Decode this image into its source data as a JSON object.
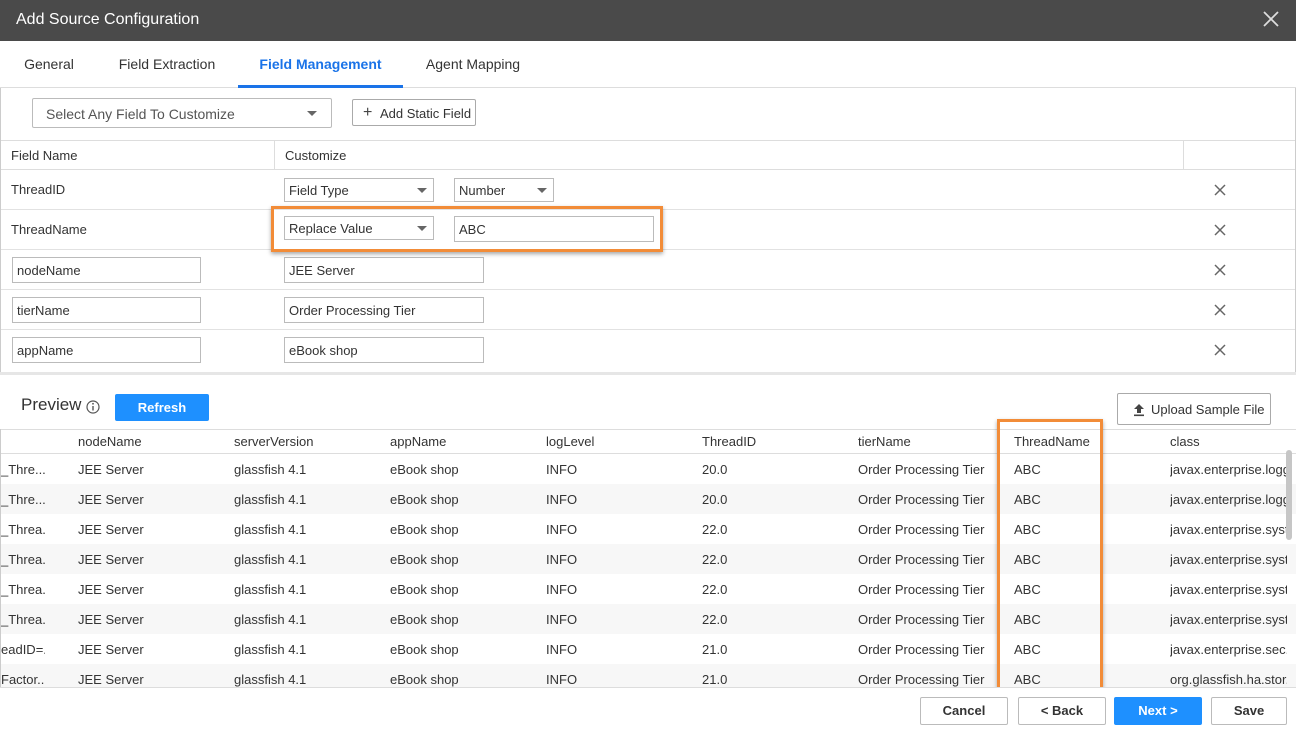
{
  "dialog": {
    "title": "Add Source Configuration",
    "close_icon": "close-icon"
  },
  "tabs": [
    {
      "label": "General",
      "active": false
    },
    {
      "label": "Field Extraction",
      "active": false
    },
    {
      "label": "Field Management",
      "active": true
    },
    {
      "label": "Agent Mapping",
      "active": false
    }
  ],
  "controls": {
    "field_select_placeholder": "Select Any Field To Customize",
    "add_static_field_label": "Add Static Field"
  },
  "field_grid": {
    "headers": [
      "Field Name",
      "Customize"
    ],
    "rows": [
      {
        "name": "ThreadID",
        "customize_type": "Field Type",
        "value": "Number"
      },
      {
        "name": "ThreadName",
        "customize_type": "Replace Value",
        "value": "ABC"
      },
      {
        "name": "nodeName",
        "value": "JEE Server"
      },
      {
        "name": "tierName",
        "value": "Order Processing Tier"
      },
      {
        "name": "appName",
        "value": "eBook shop"
      }
    ]
  },
  "preview": {
    "title": "Preview",
    "refresh_label": "Refresh",
    "upload_label": "Upload Sample File",
    "columns": [
      "",
      "nodeName",
      "serverVersion",
      "appName",
      "logLevel",
      "ThreadID",
      "tierName",
      "ThreadName",
      "class"
    ],
    "rows": [
      [
        "_Thre...",
        "JEE Server",
        "glassfish 4.1",
        "eBook shop",
        "INFO",
        "20.0",
        "Order Processing Tier",
        "ABC",
        "javax.enterprise.logg"
      ],
      [
        "_Thre...",
        "JEE Server",
        "glassfish 4.1",
        "eBook shop",
        "INFO",
        "20.0",
        "Order Processing Tier",
        "ABC",
        "javax.enterprise.logg"
      ],
      [
        "_Threa...",
        "JEE Server",
        "glassfish 4.1",
        "eBook shop",
        "INFO",
        "22.0",
        "Order Processing Tier",
        "ABC",
        "javax.enterprise.syst"
      ],
      [
        "_Threa...",
        "JEE Server",
        "glassfish 4.1",
        "eBook shop",
        "INFO",
        "22.0",
        "Order Processing Tier",
        "ABC",
        "javax.enterprise.syst"
      ],
      [
        "_Threa...",
        "JEE Server",
        "glassfish 4.1",
        "eBook shop",
        "INFO",
        "22.0",
        "Order Processing Tier",
        "ABC",
        "javax.enterprise.syst"
      ],
      [
        "_Threa...",
        "JEE Server",
        "glassfish 4.1",
        "eBook shop",
        "INFO",
        "22.0",
        "Order Processing Tier",
        "ABC",
        "javax.enterprise.syst"
      ],
      [
        "eadID=...",
        "JEE Server",
        "glassfish 4.1",
        "eBook shop",
        "INFO",
        "21.0",
        "Order Processing Tier",
        "ABC",
        "javax.enterprise.sec..."
      ],
      [
        "Factor...",
        "JEE Server",
        "glassfish 4.1",
        "eBook shop",
        "INFO",
        "21.0",
        "Order Processing Tier",
        "ABC",
        "org.glassfish.ha.stor..."
      ]
    ]
  },
  "footer": {
    "cancel": "Cancel",
    "back": "< Back",
    "next": "Next >",
    "save": "Save"
  },
  "colors": {
    "accent": "#1e90ff",
    "highlight": "#f28c38",
    "titlebar": "#4a4a4a"
  }
}
